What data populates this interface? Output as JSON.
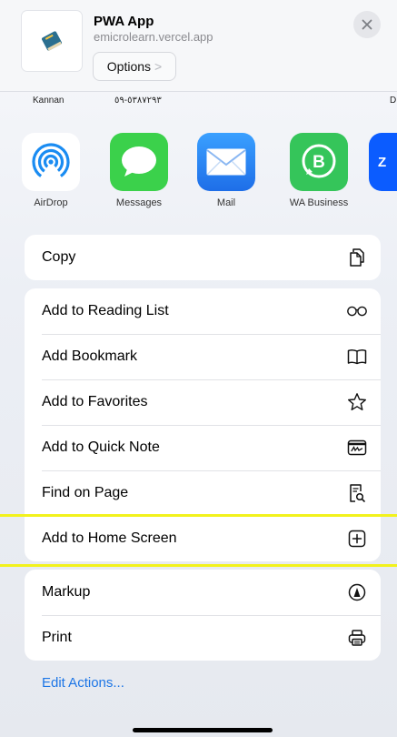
{
  "header": {
    "title": "PWA App",
    "url": "emicrolearn.vercel.app",
    "options_label": "Options",
    "options_chevron": ">"
  },
  "contacts": [
    "Kannan",
    "٥٣٨٧٢٩٣-٥٩",
    "D"
  ],
  "apps": [
    {
      "label": "AirDrop",
      "icon": "airdrop-icon",
      "color": "#1a8cf2"
    },
    {
      "label": "Messages",
      "icon": "messages-icon",
      "color": "#3bd14b"
    },
    {
      "label": "Mail",
      "icon": "mail-icon",
      "color": "#2f88f5"
    },
    {
      "label": "WA Business",
      "icon": "wa-business-icon",
      "color": "#35c55a"
    },
    {
      "label": "Z",
      "icon": "zoom-icon",
      "color": "#0b5cff"
    }
  ],
  "actions": {
    "copy": "Copy",
    "reading_list": "Add to Reading List",
    "bookmark": "Add Bookmark",
    "favorites": "Add to Favorites",
    "quick_note": "Add to Quick Note",
    "find_on_page": "Find on Page",
    "home_screen": "Add to Home Screen",
    "markup": "Markup",
    "print": "Print"
  },
  "edit_actions": "Edit Actions...",
  "colors": {
    "accent": "#1d76e6",
    "highlight": "#f2f21c"
  }
}
